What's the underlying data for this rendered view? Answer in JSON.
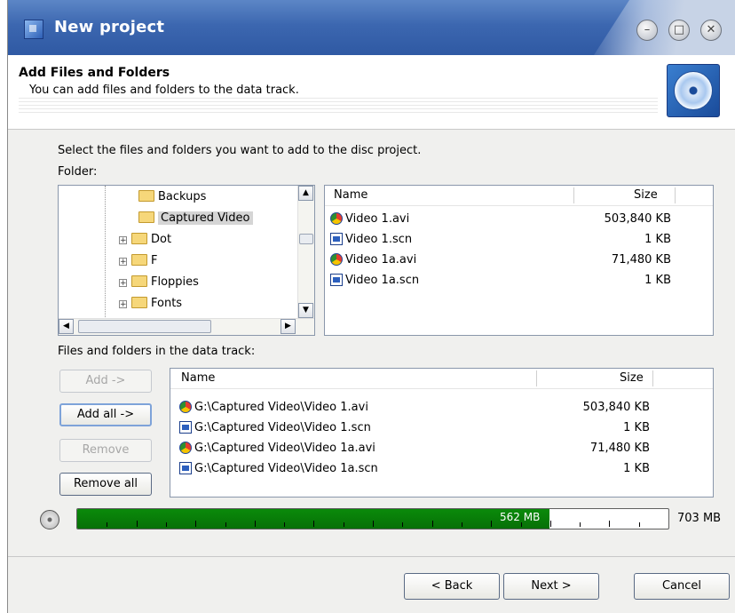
{
  "window": {
    "title": "New project"
  },
  "header": {
    "title": "Add Files and Folders",
    "subtitle": "You can add files and folders to the data track."
  },
  "instructions": "Select the files and folders you want to add to the disc project.",
  "folder_label": "Folder:",
  "tree": [
    {
      "label": "Backups",
      "expandable": false,
      "selected": false
    },
    {
      "label": "Captured Video",
      "expandable": false,
      "selected": true
    },
    {
      "label": "Dot",
      "expandable": true,
      "selected": false
    },
    {
      "label": "F",
      "expandable": true,
      "selected": false
    },
    {
      "label": "Floppies",
      "expandable": true,
      "selected": false
    },
    {
      "label": "Fonts",
      "expandable": true,
      "selected": false
    }
  ],
  "file_list": {
    "columns": {
      "name": "Name",
      "size": "Size"
    },
    "rows": [
      {
        "name": "Video 1.avi",
        "size": "503,840 KB",
        "icon": "avi-file-icon"
      },
      {
        "name": "Video 1.scn",
        "size": "1 KB",
        "icon": "scn-file-icon"
      },
      {
        "name": "Video 1a.avi",
        "size": "71,480 KB",
        "icon": "avi-file-icon"
      },
      {
        "name": "Video 1a.scn",
        "size": "1 KB",
        "icon": "scn-file-icon"
      }
    ]
  },
  "data_track_label": "Files and folders in the data track:",
  "actions": {
    "add": "Add ->",
    "add_all": "Add all ->",
    "remove": "Remove",
    "remove_all": "Remove all"
  },
  "track_list": {
    "columns": {
      "name": "Name",
      "size": "Size"
    },
    "rows": [
      {
        "name": "G:\\Captured Video\\Video 1.avi",
        "size": "503,840 KB",
        "icon": "avi-file-icon"
      },
      {
        "name": "G:\\Captured Video\\Video 1.scn",
        "size": "1 KB",
        "icon": "scn-file-icon"
      },
      {
        "name": "G:\\Captured Video\\Video 1a.avi",
        "size": "71,480 KB",
        "icon": "avi-file-icon"
      },
      {
        "name": "G:\\Captured Video\\Video 1a.scn",
        "size": "1 KB",
        "icon": "scn-file-icon"
      }
    ]
  },
  "capacity": {
    "used_label": "562 MB",
    "total_label": "703 MB",
    "used_fraction": 0.799
  },
  "footer": {
    "back": "< Back",
    "next": "Next >",
    "cancel": "Cancel"
  },
  "colors": {
    "accent": "#3c67b0",
    "progress": "#0a8a0a"
  }
}
